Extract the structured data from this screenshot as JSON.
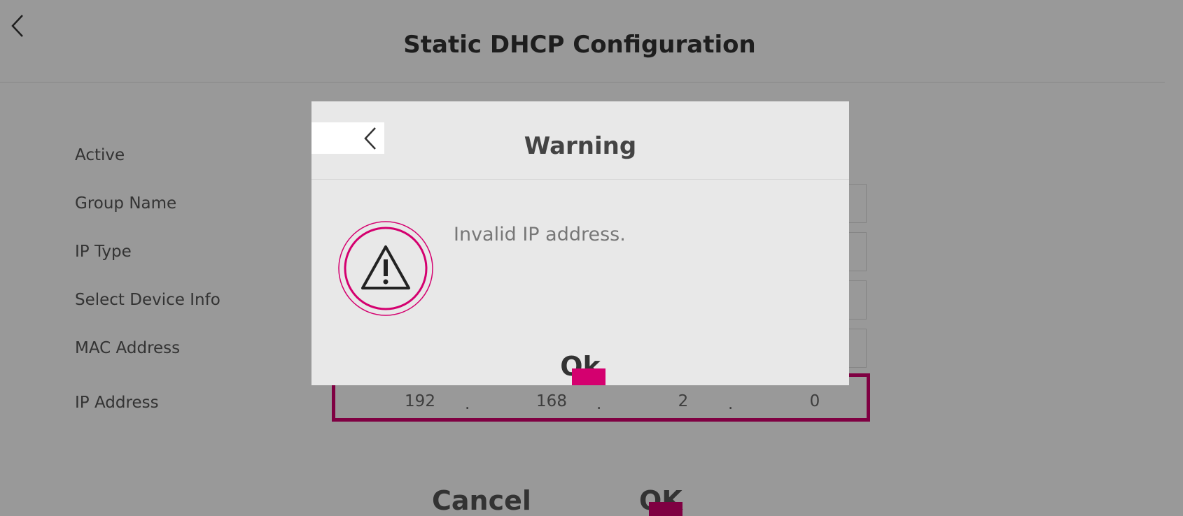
{
  "header": {
    "title": "Static DHCP Configuration"
  },
  "form": {
    "labels": {
      "active": "Active",
      "group_name": "Group Name",
      "ip_type": "IP Type",
      "select_device_info": "Select Device Info",
      "mac_address": "MAC Address",
      "ip_address": "IP Address"
    },
    "ip_segments": [
      "192",
      "168",
      "2",
      "0"
    ],
    "ip_separator": "."
  },
  "footer": {
    "cancel_label": "Cancel",
    "ok_label": "OK"
  },
  "dialog": {
    "title": "Warning",
    "message": "Invalid IP address.",
    "ok_label": "Ok",
    "icon": "warning-triangle-icon"
  },
  "colors": {
    "accent": "#d4006f"
  }
}
